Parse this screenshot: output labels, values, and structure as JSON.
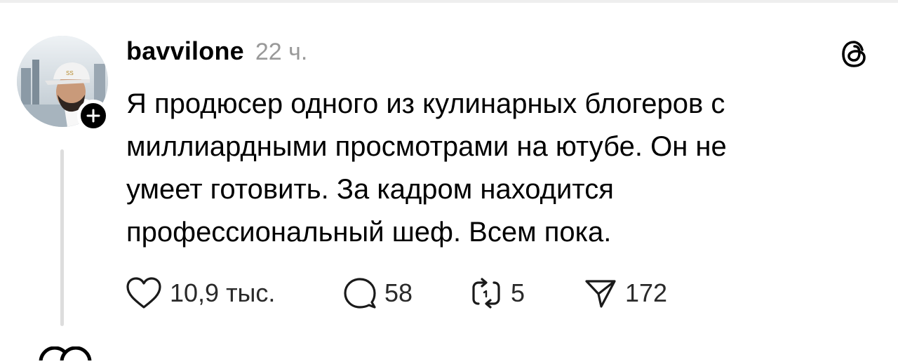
{
  "post": {
    "username": "bavvilone",
    "timestamp": "22 ч.",
    "text_lines": [
      "Я продюсер одного из кулинарных блогеров с",
      "миллиардными просмотрами на ютубе. Он не",
      "умеет готовить. За кадром находится",
      "профессиональный шеф. Всем пока."
    ]
  },
  "actions": {
    "likes": "10,9 тыс.",
    "replies": "58",
    "reposts": "5",
    "shares": "172"
  },
  "icons": {
    "avatar": "user-avatar-photo",
    "follow": "plus-icon",
    "brand": "threads-logo-icon",
    "like": "heart-icon",
    "reply": "speech-bubble-icon",
    "repost": "repost-arrows-icon",
    "share": "send-icon"
  },
  "colors": {
    "text": "#000000",
    "muted": "#999999",
    "thread_line": "#dddddd",
    "badge": "#000000"
  }
}
